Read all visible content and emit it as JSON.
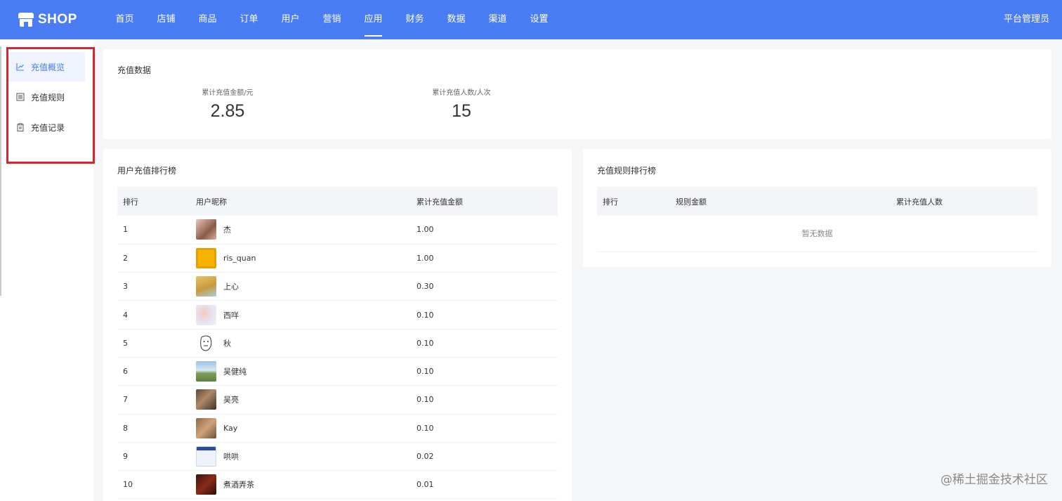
{
  "header": {
    "logo_text": "SHOP",
    "nav": [
      "首页",
      "店铺",
      "商品",
      "订单",
      "用户",
      "营销",
      "应用",
      "财务",
      "数据",
      "渠道",
      "设置"
    ],
    "active_nav": "应用",
    "user_label": "平台管理员",
    "brand_color": "#4a7cf3"
  },
  "sidebar": {
    "items": [
      {
        "label": "充值概览",
        "icon": "chart-line-icon",
        "active": true
      },
      {
        "label": "充值规则",
        "icon": "list-doc-icon",
        "active": false
      },
      {
        "label": "充值记录",
        "icon": "clipboard-icon",
        "active": false
      }
    ],
    "highlight_color": "#d9262e"
  },
  "summary": {
    "title": "充值数据",
    "stats": [
      {
        "label": "累计充值金额/元",
        "value": "2.85"
      },
      {
        "label": "累计充值人数/人次",
        "value": "15"
      }
    ]
  },
  "user_ranking": {
    "title": "用户充值排行榜",
    "columns": [
      "排行",
      "用户昵称",
      "累计充值金额"
    ],
    "rows": [
      {
        "rank": "1",
        "name": "杰",
        "amount": "1.00",
        "avatar": "avatar-photo-icon"
      },
      {
        "rank": "2",
        "name": "ris_quan",
        "amount": "1.00",
        "avatar": "avatar-yellow-icon"
      },
      {
        "rank": "3",
        "name": "上心",
        "amount": "0.30",
        "avatar": "avatar-photo-icon"
      },
      {
        "rank": "4",
        "name": "西咩",
        "amount": "0.10",
        "avatar": "avatar-pastel-icon"
      },
      {
        "rank": "5",
        "name": "秋",
        "amount": "0.10",
        "avatar": "avatar-face-sketch-icon"
      },
      {
        "rank": "6",
        "name": "吴健纯",
        "amount": "0.10",
        "avatar": "avatar-landscape-icon"
      },
      {
        "rank": "7",
        "name": "吴亮",
        "amount": "0.10",
        "avatar": "avatar-photo-icon"
      },
      {
        "rank": "8",
        "name": "Kay",
        "amount": "0.10",
        "avatar": "avatar-photo-icon"
      },
      {
        "rank": "9",
        "name": "哄哄",
        "amount": "0.02",
        "avatar": "avatar-screenshot-icon"
      },
      {
        "rank": "10",
        "name": "煮酒弄茶",
        "amount": "0.01",
        "avatar": "avatar-dark-icon"
      }
    ]
  },
  "rule_ranking": {
    "title": "充值规则排行榜",
    "columns": [
      "排行",
      "规则金额",
      "累计充值人数"
    ],
    "empty_text": "暂无数据"
  },
  "watermark": "@稀土掘金技术社区"
}
